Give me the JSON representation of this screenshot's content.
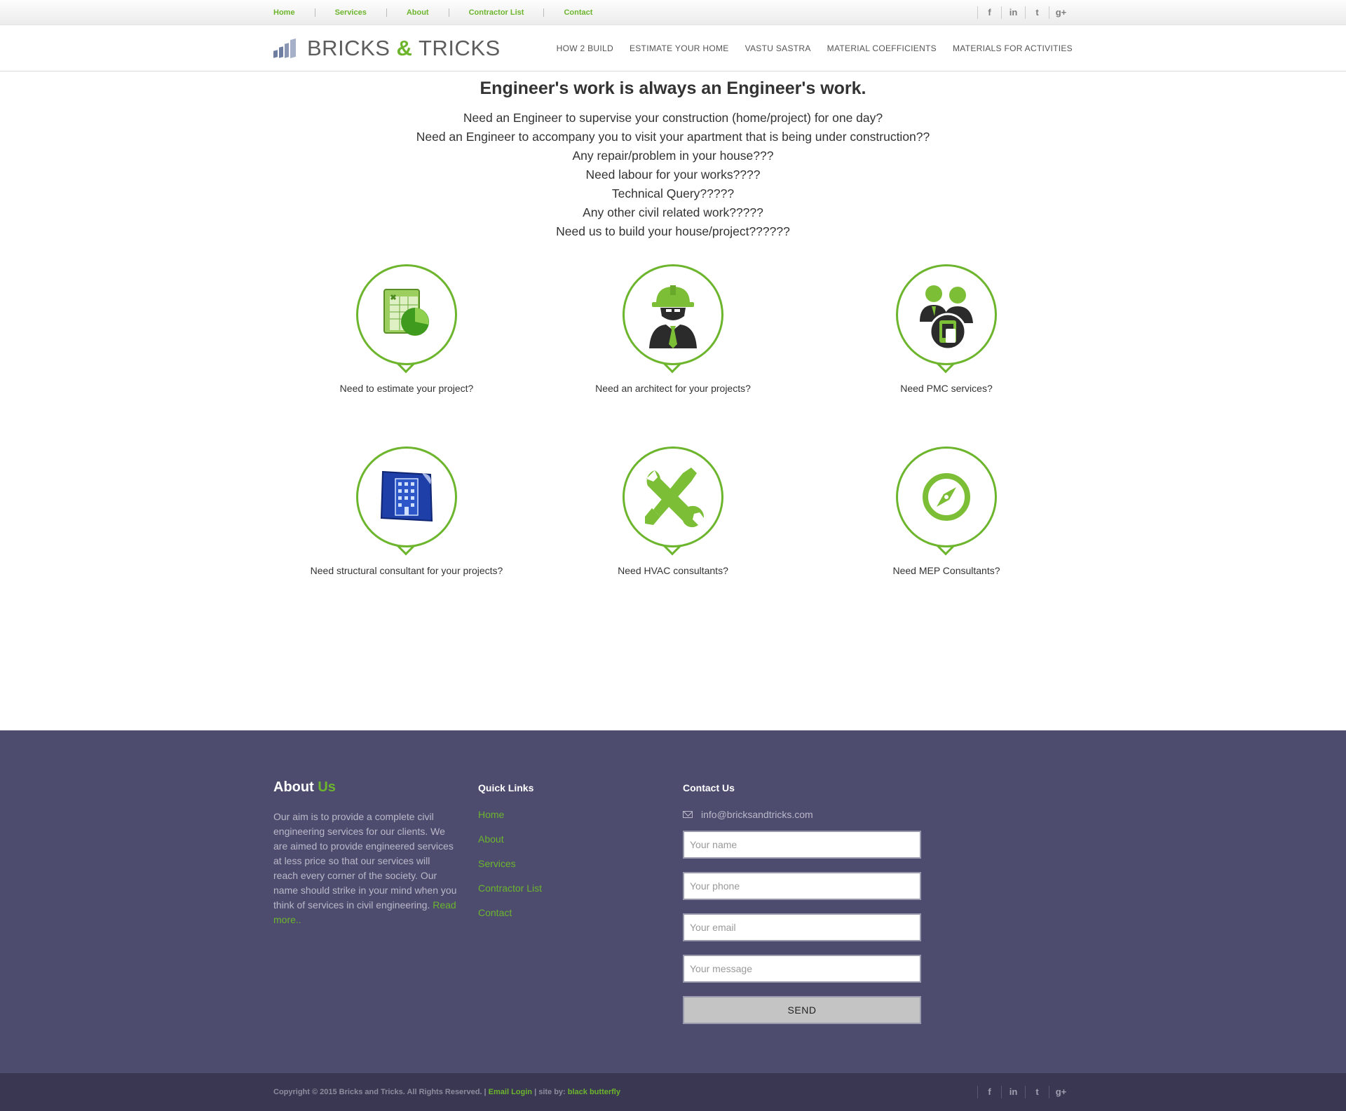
{
  "topbar": {
    "links": [
      "Home",
      "Services",
      "About",
      "Contractor List",
      "Contact"
    ],
    "social": [
      {
        "icon": "facebook-icon",
        "glyph": "f"
      },
      {
        "icon": "linkedin-icon",
        "glyph": "in"
      },
      {
        "icon": "twitter-icon",
        "glyph": "t"
      },
      {
        "icon": "googleplus-icon",
        "glyph": "g+"
      }
    ]
  },
  "header": {
    "logo_left": "BRICKS",
    "logo_amp": "&",
    "logo_right": "TRICKS",
    "nav": [
      "HOW 2 BUILD",
      "ESTIMATE YOUR HOME",
      "VASTU SASTRA",
      "MATERIAL COEFFICIENTS",
      "MATERIALS FOR ACTIVITIES"
    ]
  },
  "main": {
    "title": "Engineer's work is always an Engineer's work.",
    "intro": [
      "Need an Engineer to supervise your construction (home/project) for one day?",
      "Need an Engineer to accompany you to visit your apartment that is being under construction??",
      "Any repair/problem in your house???",
      "Need labour for your works????",
      "Technical Query?????",
      "Any other civil related work?????",
      "Need us to build your house/project??????"
    ],
    "services": [
      {
        "label": "Need to estimate your project?",
        "icon": "spreadsheet-chart-icon"
      },
      {
        "label": "Need an architect for your projects?",
        "icon": "engineer-helmet-icon"
      },
      {
        "label": "Need PMC services?",
        "icon": "team-device-icon"
      },
      {
        "label": "Need structural consultant for your projects?",
        "icon": "blueprint-building-icon"
      },
      {
        "label": "Need HVAC consultants?",
        "icon": "wrench-screwdriver-icon"
      },
      {
        "label": "Need MEP Consultants?",
        "icon": "compass-icon"
      }
    ]
  },
  "footer": {
    "about_title": "About",
    "about_title_hl": "Us",
    "about_text": "Our aim is to provide a complete civil engineering services for our clients. We are aimed to provide engineered services at less price so that our services will reach every corner of the society. Our name should strike in your mind when you think of services in civil engineering.",
    "read_more": "Read more..",
    "quick_title": "Quick Links",
    "quick_links": [
      "Home",
      "About",
      "Services",
      "Contractor List",
      "Contact"
    ],
    "contact_title": "Contact Us",
    "email": "info@bricksandtricks.com",
    "placeholders": {
      "name": "Your name",
      "phone": "Your phone",
      "email": "Your email",
      "message": "Your message"
    },
    "send_label": "SEND"
  },
  "bottom": {
    "copyright": "Copyright © 2015 Bricks and Tricks. All Rights Reserved.",
    "sep1": " | ",
    "email_login": "Email Login",
    "site_by": " | site by: ",
    "author": "black butterfly"
  },
  "colors": {
    "accent": "#6cb52d",
    "footer_bg": "#4d4c6e",
    "bottom_bg": "#393751"
  }
}
